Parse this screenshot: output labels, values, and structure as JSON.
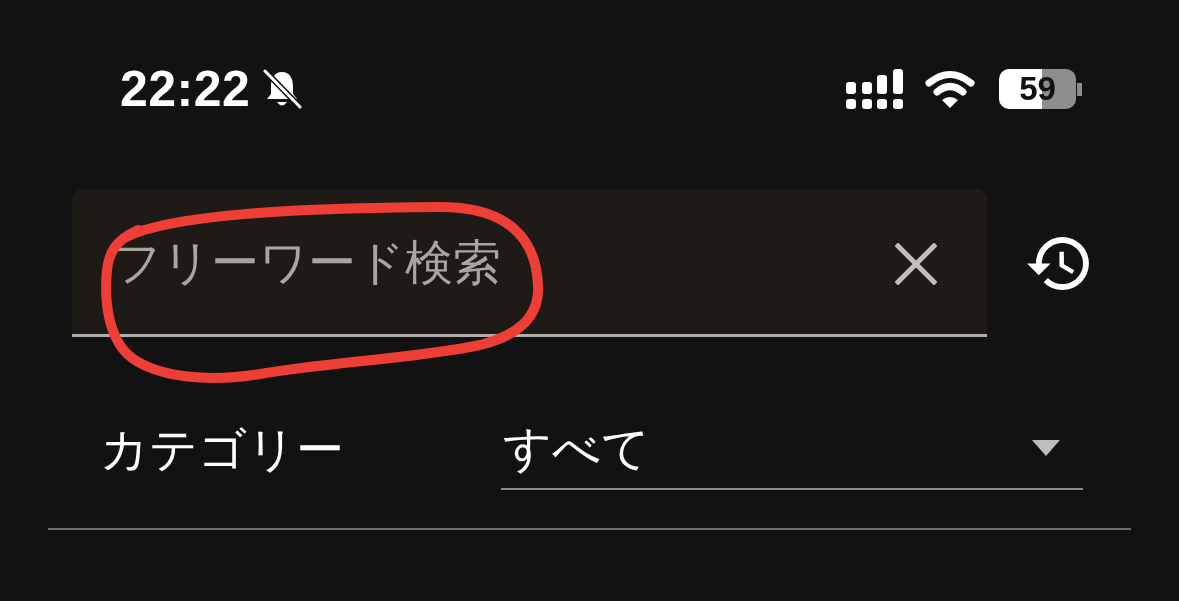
{
  "status_bar": {
    "time": "22:22",
    "silent": true,
    "battery": "59"
  },
  "search": {
    "placeholder": "フリーワード検索"
  },
  "filter": {
    "label": "カテゴリー",
    "value": "すべて"
  },
  "annotations": [
    {
      "kind": "circle"
    }
  ]
}
